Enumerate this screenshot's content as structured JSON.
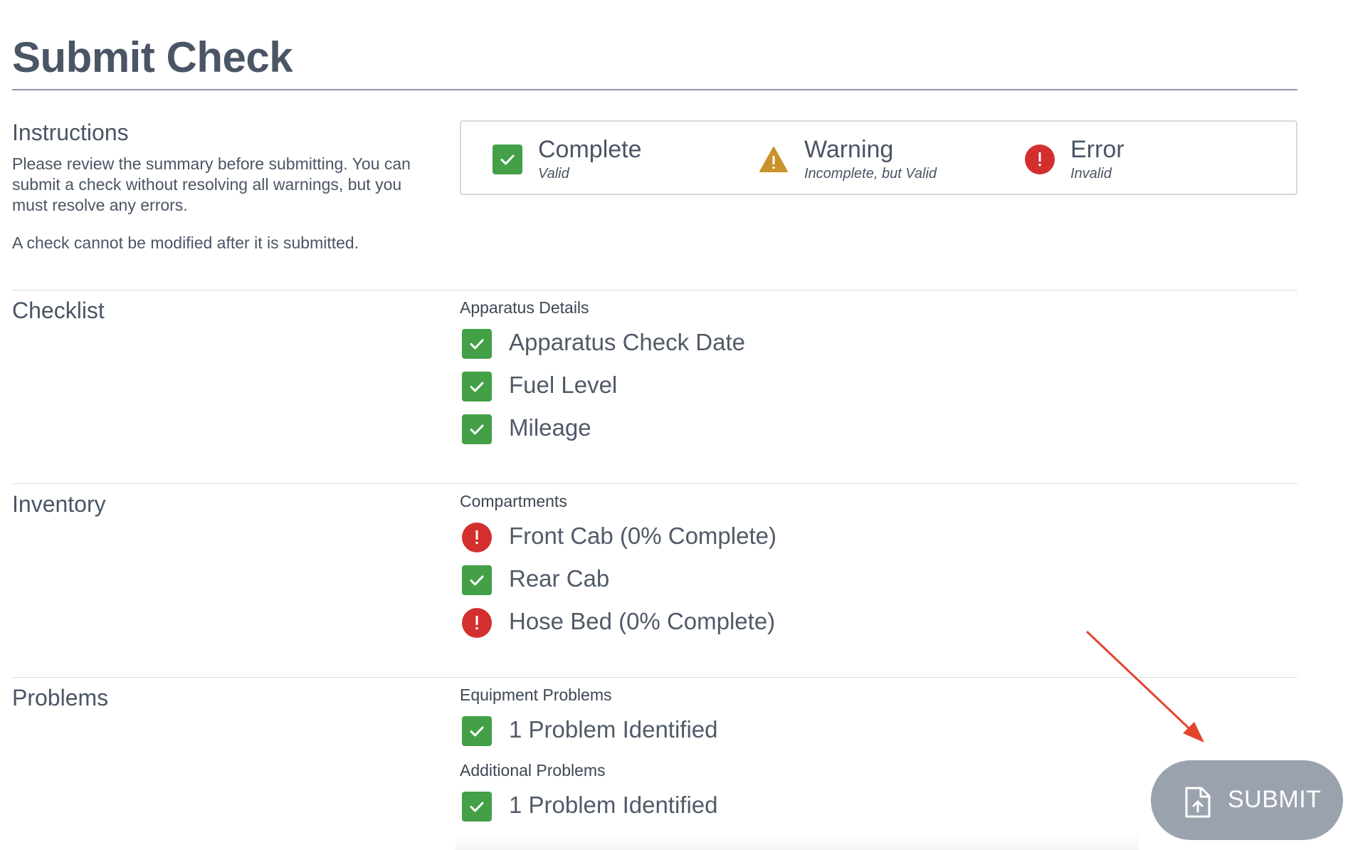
{
  "page": {
    "title": "Submit Check"
  },
  "instructions": {
    "heading": "Instructions",
    "text": "Please review the summary before submitting. You can submit a check without resolving all warnings, but you must resolve any errors.",
    "note": "A check cannot be modified after it is submitted."
  },
  "legend": {
    "complete": {
      "label": "Complete",
      "sub": "Valid",
      "icon": "check-square-icon",
      "color": "#43a047"
    },
    "warning": {
      "label": "Warning",
      "sub": "Incomplete, but Valid",
      "icon": "warning-triangle-icon",
      "color": "#c9922b"
    },
    "error": {
      "label": "Error",
      "sub": "Invalid",
      "icon": "error-circle-icon",
      "color": "#d32f2f"
    }
  },
  "checklist": {
    "heading": "Checklist",
    "group": "Apparatus Details",
    "items": [
      {
        "label": "Apparatus Check Date",
        "status": "complete"
      },
      {
        "label": "Fuel Level",
        "status": "complete"
      },
      {
        "label": "Mileage",
        "status": "complete"
      }
    ]
  },
  "inventory": {
    "heading": "Inventory",
    "group": "Compartments",
    "items": [
      {
        "label": "Front Cab (0% Complete)",
        "status": "error"
      },
      {
        "label": "Rear Cab",
        "status": "complete"
      },
      {
        "label": "Hose Bed (0% Complete)",
        "status": "error"
      }
    ]
  },
  "problems": {
    "heading": "Problems",
    "equipment_group": "Equipment Problems",
    "equipment_item": {
      "label": "1 Problem Identified",
      "status": "complete"
    },
    "additional_group": "Additional Problems",
    "additional_item": {
      "label": "1 Problem Identified",
      "status": "complete"
    }
  },
  "submit": {
    "label": "SUBMIT",
    "icon": "file-upload-icon",
    "color": "#9aa2ae"
  },
  "annotation": {
    "arrow_color": "#e2452c"
  }
}
